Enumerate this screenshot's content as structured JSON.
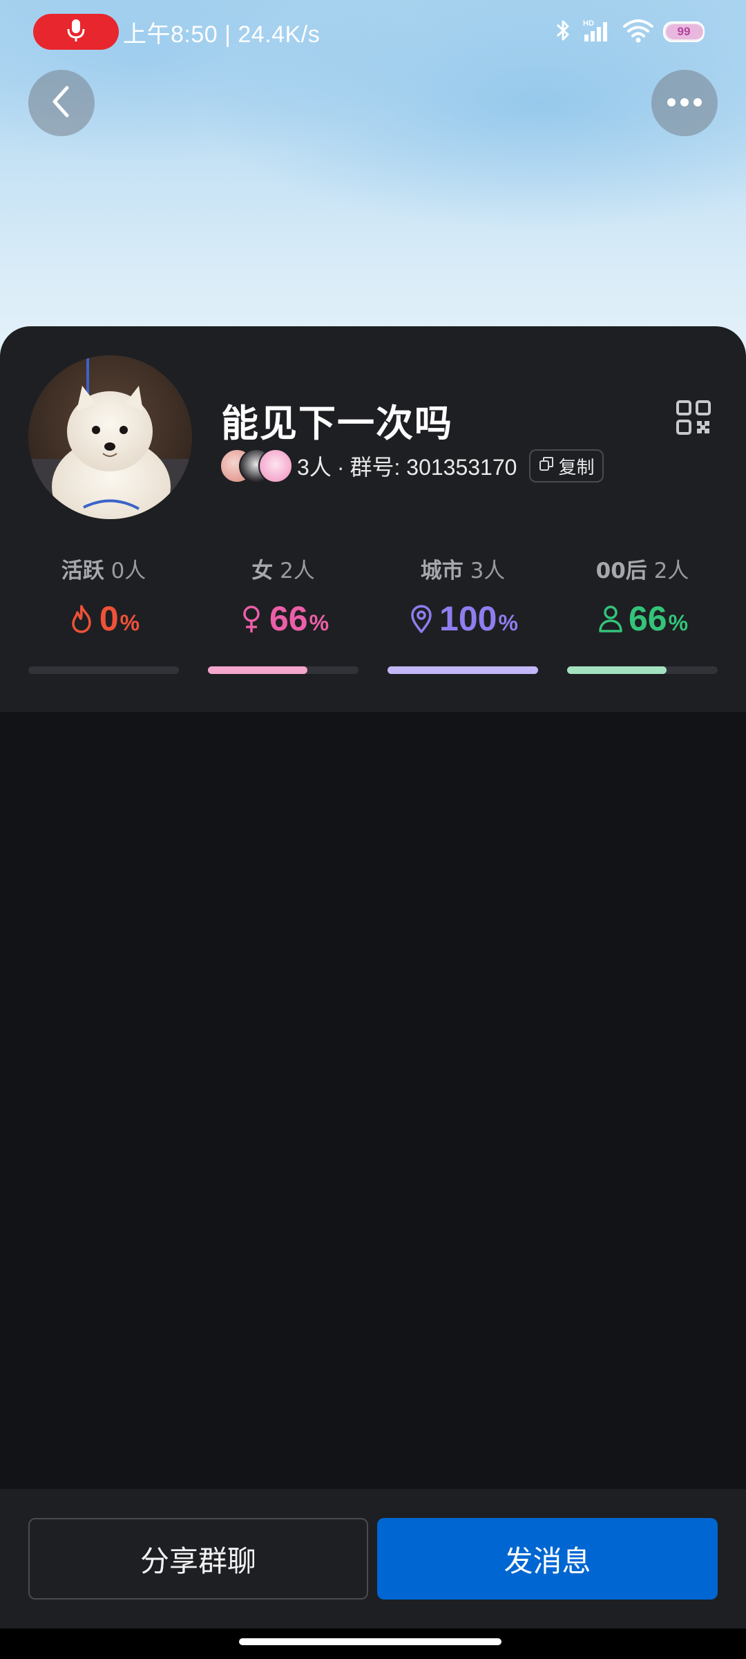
{
  "status_bar": {
    "time_and_speed": "上午8:50 | 24.4K/s",
    "battery_level": "99",
    "battery_color": "#b2449b",
    "icons": [
      "mic-icon",
      "bluetooth-icon",
      "hd-signal-icon",
      "wifi-icon",
      "battery-icon"
    ]
  },
  "header": {
    "back_icon": "chevron-left-icon",
    "more_icon": "more-dots-icon"
  },
  "group": {
    "name": "能见下一次吗",
    "member_count": "3人",
    "separator": "·",
    "id_label": "群号:",
    "id": "301353170",
    "copy_label": "复制",
    "qr_icon": "qr-code-icon"
  },
  "stats": [
    {
      "label": "活跃",
      "count": "0人",
      "value": "0",
      "unit": "%",
      "fraction": 0.0,
      "color": "#ef5239",
      "track_color": "#ef5239",
      "icon": "flame-icon"
    },
    {
      "label": "女",
      "count": "2人",
      "value": "66",
      "unit": "%",
      "fraction": 0.66,
      "color": "#ec5fa8",
      "track_color": "#f4a6cc",
      "icon": "female-icon"
    },
    {
      "label": "城市",
      "count": "3人",
      "value": "100",
      "unit": "%",
      "fraction": 1.0,
      "color": "#8e7ef0",
      "track_color": "#c3b7f7",
      "icon": "location-pin-icon"
    },
    {
      "label": "00后",
      "count": "2人",
      "value": "66",
      "unit": "%",
      "fraction": 0.66,
      "color": "#33c47a",
      "track_color": "#a4e2c1",
      "icon": "person-icon"
    }
  ],
  "actions": {
    "share_label": "分享群聊",
    "send_label": "发消息",
    "send_color": "#0066d1"
  }
}
